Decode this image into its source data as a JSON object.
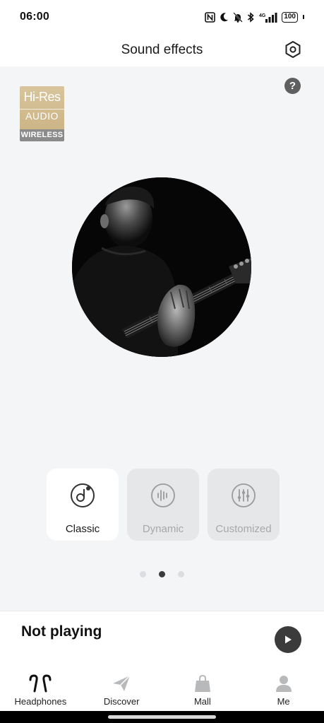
{
  "status_bar": {
    "time": "06:00",
    "battery": "100",
    "icons": [
      "nfc-icon",
      "moon-icon",
      "bell-muted-icon",
      "bluetooth-icon",
      "signal-4g-icon",
      "battery-icon"
    ]
  },
  "header": {
    "title": "Sound effects",
    "settings_icon": "hexagon-settings-icon"
  },
  "badge": {
    "line1": "Hi-Res",
    "line2": "AUDIO",
    "line3": "WIRELESS"
  },
  "help": {
    "label": "?"
  },
  "album_art": {
    "description_icon": "guitarist-photo"
  },
  "effects": [
    {
      "label": "Classic",
      "icon": "music-note-circle-icon",
      "active": true
    },
    {
      "label": "Dynamic",
      "icon": "waveform-circle-icon",
      "active": false
    },
    {
      "label": "Customized",
      "icon": "equalizer-circle-icon",
      "active": false
    }
  ],
  "pager": {
    "count": 3,
    "active_index": 1
  },
  "now_playing": {
    "status": "Not playing",
    "button_icon": "play-icon"
  },
  "nav": {
    "items": [
      {
        "label": "Headphones",
        "icon": "earbuds-icon"
      },
      {
        "label": "Discover",
        "icon": "paper-plane-icon"
      },
      {
        "label": "Mall",
        "icon": "shopping-bag-icon"
      },
      {
        "label": "Me",
        "icon": "person-icon"
      }
    ]
  },
  "colors": {
    "background": "#f4f5f7",
    "card_active": "#ffffff",
    "card_inactive": "#e6e7e9",
    "play_button": "#3b3b3b"
  }
}
